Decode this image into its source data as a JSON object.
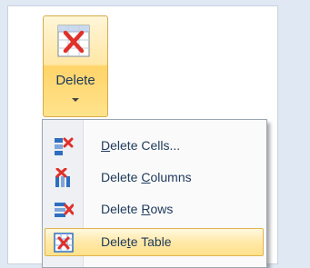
{
  "ribbon": {
    "delete_button": {
      "label": "Delete",
      "icon": "delete-table-icon"
    }
  },
  "menu": {
    "items": [
      {
        "label_parts": [
          "",
          "D",
          "elete Cells..."
        ],
        "icon": "delete-cells-icon",
        "highlighted": false
      },
      {
        "label_parts": [
          "Delete ",
          "C",
          "olumns"
        ],
        "icon": "delete-columns-icon",
        "highlighted": false
      },
      {
        "label_parts": [
          "Delete ",
          "R",
          "ows"
        ],
        "icon": "delete-rows-icon",
        "highlighted": false
      },
      {
        "label_parts": [
          "Dele",
          "t",
          "e Table"
        ],
        "icon": "delete-table-icon",
        "highlighted": true
      }
    ]
  },
  "colors": {
    "accent_red": "#e0302a",
    "grid_blue": "#2e6ec0",
    "highlight": "#ffe38c",
    "text": "#1e395b"
  }
}
